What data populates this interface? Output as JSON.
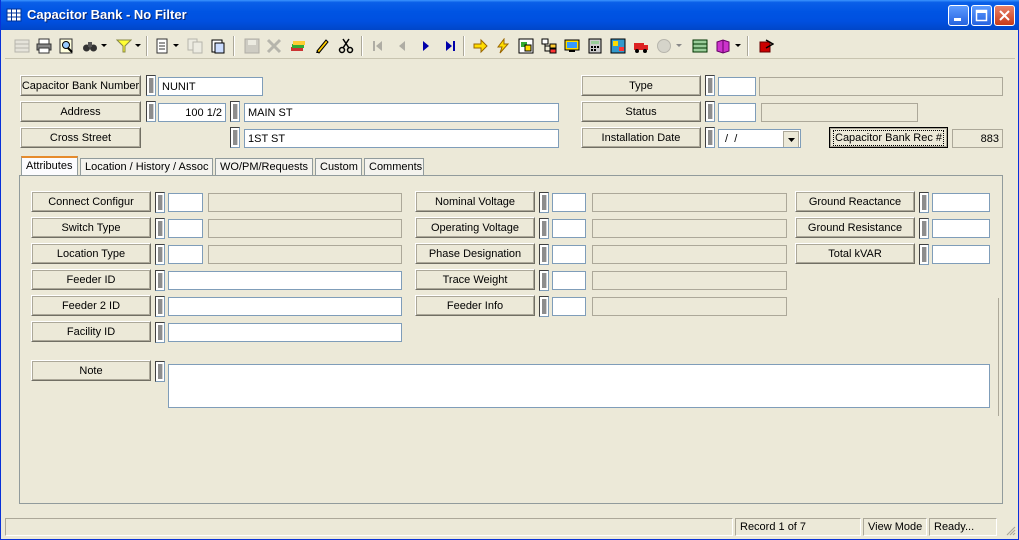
{
  "window": {
    "title": "Capacitor Bank - No Filter"
  },
  "header": {
    "capacitor_bank_number_label": "Capacitor Bank Number",
    "capacitor_bank_number_value": "NUNIT",
    "address_label": "Address",
    "address_number": "100 1/2",
    "address_street": "MAIN ST",
    "cross_street_label": "Cross Street",
    "cross_street_value": "1ST ST",
    "type_label": "Type",
    "type_code": "",
    "type_desc": "",
    "status_label": "Status",
    "status_code": "",
    "status_desc": "",
    "installation_date_label": "Installation Date",
    "installation_date_value": " /  /",
    "rec_label": "Capacitor Bank Rec #",
    "rec_value": "883"
  },
  "tabs": [
    {
      "label": "Attributes",
      "active": true
    },
    {
      "label": "Location / History / Assoc"
    },
    {
      "label": "WO/PM/Requests"
    },
    {
      "label": "Custom"
    },
    {
      "label": "Comments"
    }
  ],
  "attributes": {
    "connect_configur": "Connect Configur",
    "switch_type": "Switch Type",
    "location_type": "Location Type",
    "feeder_id": "Feeder ID",
    "feeder_2_id": "Feeder 2 ID",
    "facility_id": "Facility ID",
    "note": "Note",
    "nominal_voltage": "Nominal Voltage",
    "operating_voltage": "Operating Voltage",
    "phase_designation": "Phase Designation",
    "trace_weight": "Trace Weight",
    "feeder_info": "Feeder Info",
    "ground_reactance": "Ground Reactance",
    "ground_resistance": "Ground Resistance",
    "total_kvar": "Total kVAR"
  },
  "status": {
    "record": "Record 1 of 7",
    "mode": "View Mode",
    "state": "Ready..."
  },
  "colors": {
    "titlebar": "#0054e3",
    "face": "#ece9d8",
    "tab_highlight": "#e68b2c"
  }
}
